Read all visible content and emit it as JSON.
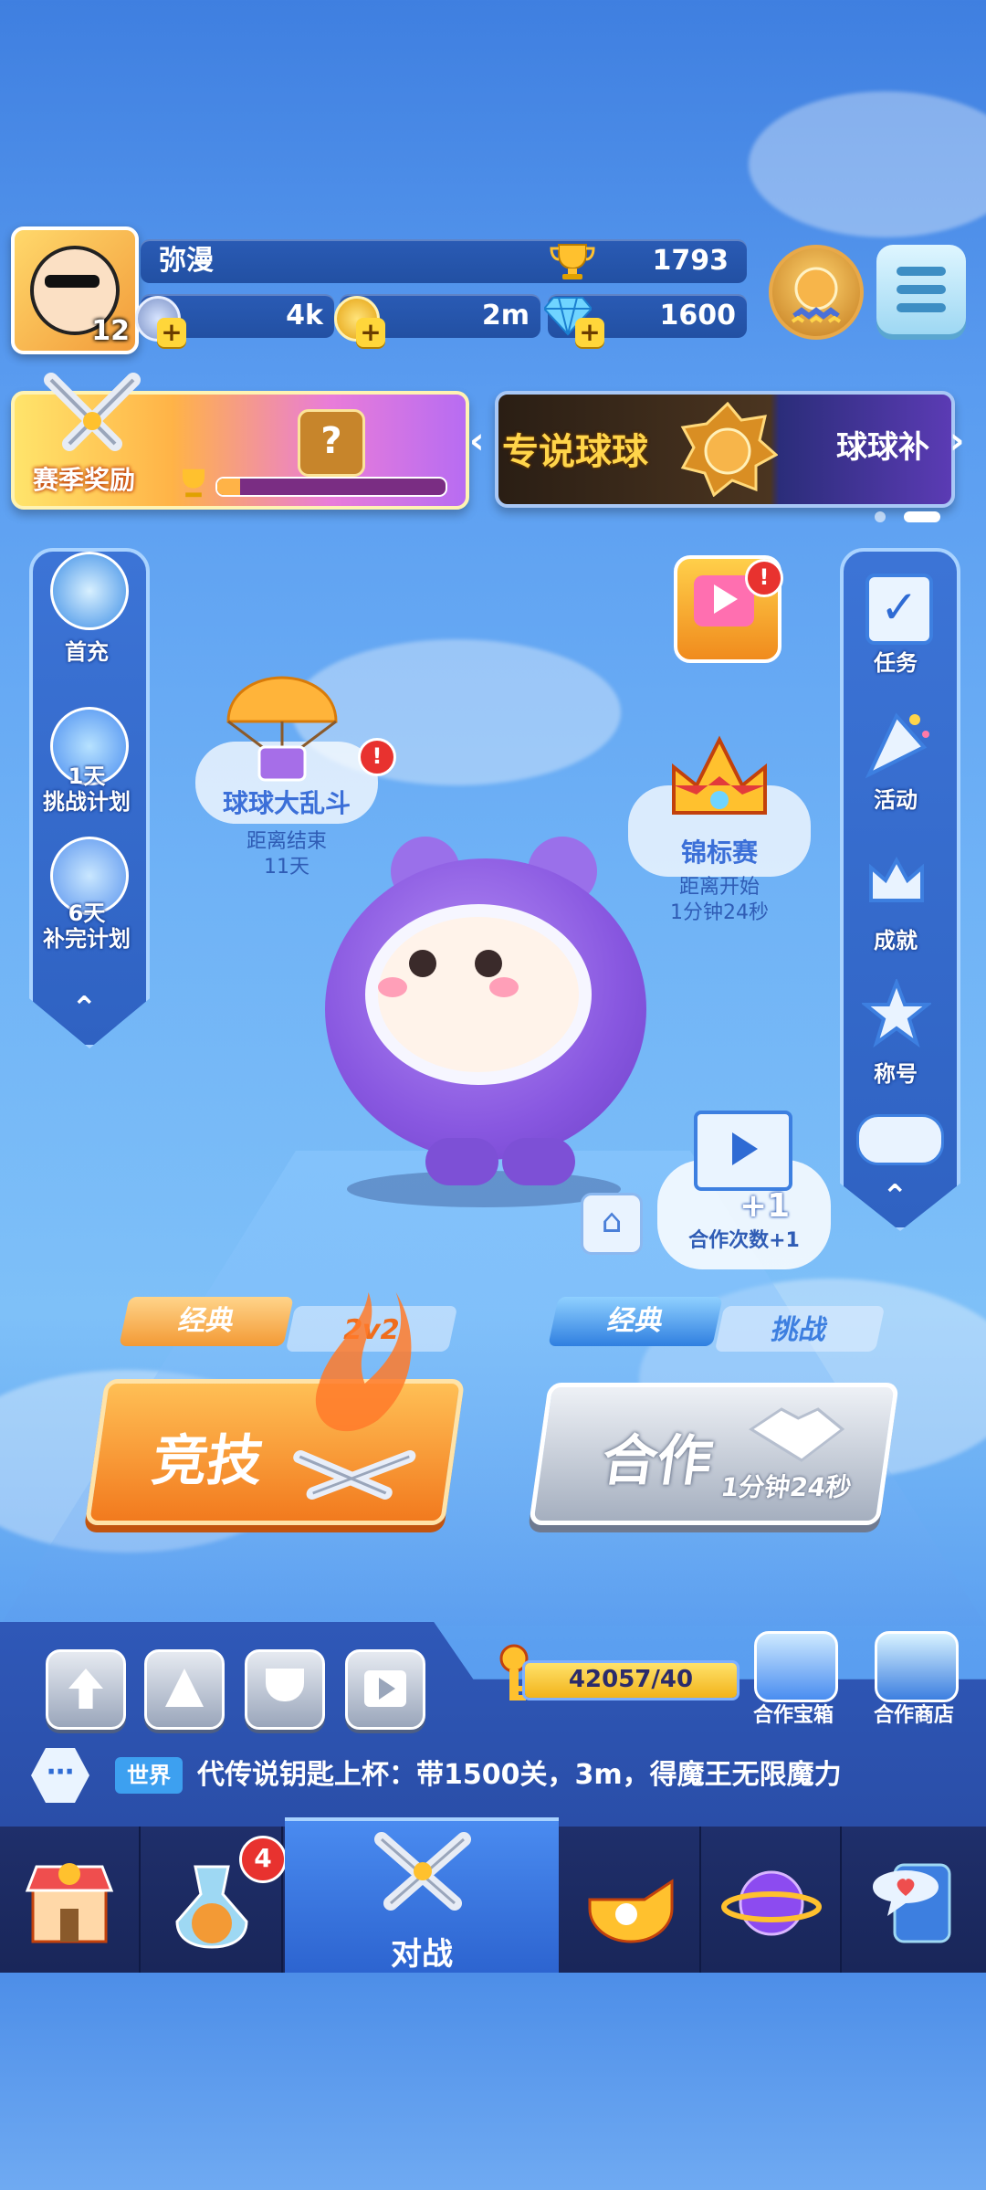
{
  "player": {
    "name": "弥漫",
    "level": "12",
    "trophies": "1793",
    "currency_stars": "4k",
    "currency_coins": "2m",
    "currency_gems": "1600"
  },
  "banners": {
    "season_label": "赛季奖励",
    "season_progress": 0.1,
    "legend_text": "专说球球",
    "legend_text2": "球球补"
  },
  "left_panel": [
    {
      "label": "首充",
      "icon": "mask-icon"
    },
    {
      "top": "1天",
      "label": "挑战计划",
      "icon": "star-badge-icon"
    },
    {
      "top": "6天",
      "label": "补完计划",
      "icon": "star-fan-icon"
    }
  ],
  "right_panel": [
    {
      "label": "任务",
      "icon": "checklist-icon"
    },
    {
      "label": "活动",
      "icon": "party-popper-icon"
    },
    {
      "label": "成就",
      "icon": "crown-badge-icon"
    },
    {
      "label": "称号",
      "icon": "star-laurel-icon"
    }
  ],
  "events": {
    "brawl_title": "球球大乱斗",
    "brawl_sub1": "距离结束",
    "brawl_sub2": "11天",
    "championship_title": "锦标赛",
    "championship_sub1": "距离开始",
    "championship_sub2": "1分钟24秒",
    "badge": "!"
  },
  "coop_bubble": {
    "plus": "+1",
    "label": "合作次数+1"
  },
  "modes": {
    "left_tag": "经典",
    "left_tag2": "2v2",
    "left_button": "竞技",
    "right_tag": "经典",
    "right_tag2": "挑战",
    "right_button": "合作",
    "right_timer": "1分钟24秒"
  },
  "bottom": {
    "key_progress": "42057/40",
    "coop_chest": "合作宝箱",
    "coop_shop": "合作商店",
    "chat_channel": "世界",
    "chat_message": "代传说钥匙上杯：带1500关，3m，得魔王无限魔力"
  },
  "nav": {
    "active_label": "对战",
    "bag_badge": "4"
  }
}
